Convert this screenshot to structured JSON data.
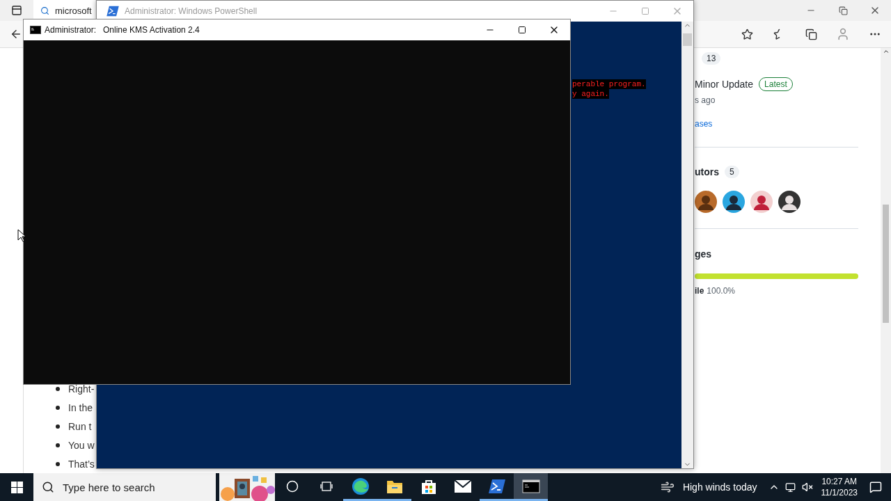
{
  "browser": {
    "tab": {
      "label": "microsoft"
    },
    "list_items": [
      "Right-",
      "In the",
      "Run t",
      "You w",
      "That’s"
    ],
    "sidebar": {
      "count_badge": "13",
      "release_title": "Minor Update",
      "release_badge": "Latest",
      "release_time": "s ago",
      "releases_link": "ases",
      "contributors_heading": "utors",
      "contributors_count": "5",
      "languages_heading": "ges",
      "language": {
        "name": "ile",
        "percent": "100.0%",
        "level": 1
      }
    }
  },
  "powershell": {
    "title": "Administrator: Windows PowerShell",
    "active": false,
    "error_lines": [
      "perable program.",
      "y again."
    ]
  },
  "kms": {
    "title_prefix": "Administrator:",
    "title": "Online KMS Activation 2.4",
    "active": true
  },
  "taskbar": {
    "search_placeholder": "Type here to search",
    "apps": [
      {
        "kind": "cortana",
        "running": false,
        "selected": false
      },
      {
        "kind": "taskview",
        "running": false,
        "selected": false
      },
      {
        "kind": "edge",
        "running": true,
        "selected": false
      },
      {
        "kind": "explorer",
        "running": true,
        "selected": false
      },
      {
        "kind": "store",
        "running": false,
        "selected": false
      },
      {
        "kind": "mail",
        "running": false,
        "selected": false
      },
      {
        "kind": "powershell",
        "running": true,
        "selected": false
      },
      {
        "kind": "cmd",
        "running": true,
        "selected": true
      }
    ],
    "weather": "High winds today",
    "time": "10:27 AM",
    "date": "11/1/2023"
  }
}
